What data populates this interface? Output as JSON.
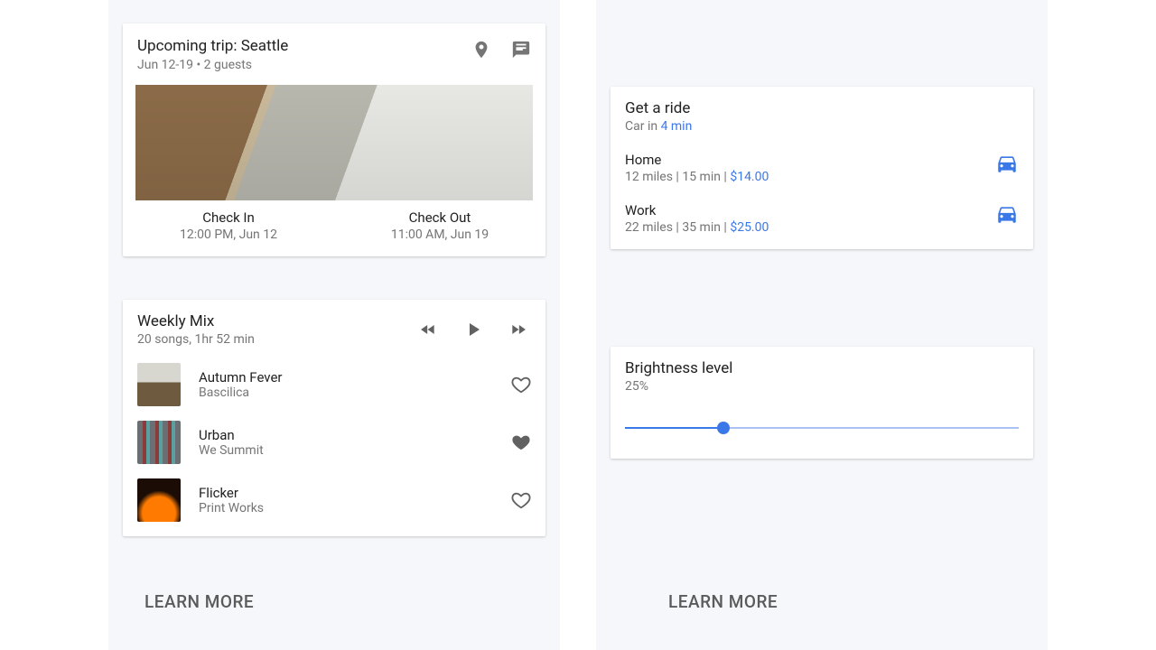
{
  "trip": {
    "title": "Upcoming trip: Seattle",
    "subtitle": "Jun 12-19 • 2 guests",
    "checkin_label": "Check In",
    "checkin_value": "12:00 PM, Jun 12",
    "checkout_label": "Check Out",
    "checkout_value": "11:00 AM, Jun 19"
  },
  "music": {
    "title": "Weekly Mix",
    "subtitle": "20 songs, 1hr 52 min",
    "songs": [
      {
        "name": "Autumn Fever",
        "artist": "Bascilica",
        "liked": false
      },
      {
        "name": "Urban",
        "artist": "We Summit",
        "liked": true
      },
      {
        "name": "Flicker",
        "artist": "Print Works",
        "liked": false
      }
    ]
  },
  "ride": {
    "title": "Get a ride",
    "eta_prefix": "Car in ",
    "eta_value": "4 min",
    "destinations": [
      {
        "name": "Home",
        "distance": "12 miles",
        "time": "15 min",
        "price": "$14.00"
      },
      {
        "name": "Work",
        "distance": "22 miles",
        "time": "35 min",
        "price": "$25.00"
      }
    ]
  },
  "brightness": {
    "title": "Brightness level",
    "value_label": "25%",
    "value": 25
  },
  "learn_more": "LEARN MORE",
  "sep": "  |  "
}
